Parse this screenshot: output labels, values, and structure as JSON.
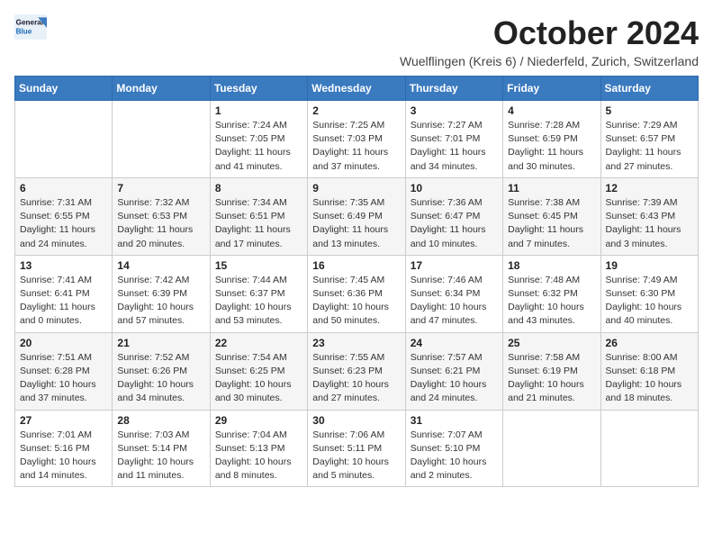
{
  "header": {
    "logo_line1": "General",
    "logo_line2": "Blue",
    "title": "October 2024",
    "subtitle": "Wuelflingen (Kreis 6) / Niederfeld, Zurich, Switzerland"
  },
  "days_of_week": [
    "Sunday",
    "Monday",
    "Tuesday",
    "Wednesday",
    "Thursday",
    "Friday",
    "Saturday"
  ],
  "weeks": [
    [
      {
        "day": "",
        "sunrise": "",
        "sunset": "",
        "daylight": ""
      },
      {
        "day": "",
        "sunrise": "",
        "sunset": "",
        "daylight": ""
      },
      {
        "day": "1",
        "sunrise": "Sunrise: 7:24 AM",
        "sunset": "Sunset: 7:05 PM",
        "daylight": "Daylight: 11 hours and 41 minutes."
      },
      {
        "day": "2",
        "sunrise": "Sunrise: 7:25 AM",
        "sunset": "Sunset: 7:03 PM",
        "daylight": "Daylight: 11 hours and 37 minutes."
      },
      {
        "day": "3",
        "sunrise": "Sunrise: 7:27 AM",
        "sunset": "Sunset: 7:01 PM",
        "daylight": "Daylight: 11 hours and 34 minutes."
      },
      {
        "day": "4",
        "sunrise": "Sunrise: 7:28 AM",
        "sunset": "Sunset: 6:59 PM",
        "daylight": "Daylight: 11 hours and 30 minutes."
      },
      {
        "day": "5",
        "sunrise": "Sunrise: 7:29 AM",
        "sunset": "Sunset: 6:57 PM",
        "daylight": "Daylight: 11 hours and 27 minutes."
      }
    ],
    [
      {
        "day": "6",
        "sunrise": "Sunrise: 7:31 AM",
        "sunset": "Sunset: 6:55 PM",
        "daylight": "Daylight: 11 hours and 24 minutes."
      },
      {
        "day": "7",
        "sunrise": "Sunrise: 7:32 AM",
        "sunset": "Sunset: 6:53 PM",
        "daylight": "Daylight: 11 hours and 20 minutes."
      },
      {
        "day": "8",
        "sunrise": "Sunrise: 7:34 AM",
        "sunset": "Sunset: 6:51 PM",
        "daylight": "Daylight: 11 hours and 17 minutes."
      },
      {
        "day": "9",
        "sunrise": "Sunrise: 7:35 AM",
        "sunset": "Sunset: 6:49 PM",
        "daylight": "Daylight: 11 hours and 13 minutes."
      },
      {
        "day": "10",
        "sunrise": "Sunrise: 7:36 AM",
        "sunset": "Sunset: 6:47 PM",
        "daylight": "Daylight: 11 hours and 10 minutes."
      },
      {
        "day": "11",
        "sunrise": "Sunrise: 7:38 AM",
        "sunset": "Sunset: 6:45 PM",
        "daylight": "Daylight: 11 hours and 7 minutes."
      },
      {
        "day": "12",
        "sunrise": "Sunrise: 7:39 AM",
        "sunset": "Sunset: 6:43 PM",
        "daylight": "Daylight: 11 hours and 3 minutes."
      }
    ],
    [
      {
        "day": "13",
        "sunrise": "Sunrise: 7:41 AM",
        "sunset": "Sunset: 6:41 PM",
        "daylight": "Daylight: 11 hours and 0 minutes."
      },
      {
        "day": "14",
        "sunrise": "Sunrise: 7:42 AM",
        "sunset": "Sunset: 6:39 PM",
        "daylight": "Daylight: 10 hours and 57 minutes."
      },
      {
        "day": "15",
        "sunrise": "Sunrise: 7:44 AM",
        "sunset": "Sunset: 6:37 PM",
        "daylight": "Daylight: 10 hours and 53 minutes."
      },
      {
        "day": "16",
        "sunrise": "Sunrise: 7:45 AM",
        "sunset": "Sunset: 6:36 PM",
        "daylight": "Daylight: 10 hours and 50 minutes."
      },
      {
        "day": "17",
        "sunrise": "Sunrise: 7:46 AM",
        "sunset": "Sunset: 6:34 PM",
        "daylight": "Daylight: 10 hours and 47 minutes."
      },
      {
        "day": "18",
        "sunrise": "Sunrise: 7:48 AM",
        "sunset": "Sunset: 6:32 PM",
        "daylight": "Daylight: 10 hours and 43 minutes."
      },
      {
        "day": "19",
        "sunrise": "Sunrise: 7:49 AM",
        "sunset": "Sunset: 6:30 PM",
        "daylight": "Daylight: 10 hours and 40 minutes."
      }
    ],
    [
      {
        "day": "20",
        "sunrise": "Sunrise: 7:51 AM",
        "sunset": "Sunset: 6:28 PM",
        "daylight": "Daylight: 10 hours and 37 minutes."
      },
      {
        "day": "21",
        "sunrise": "Sunrise: 7:52 AM",
        "sunset": "Sunset: 6:26 PM",
        "daylight": "Daylight: 10 hours and 34 minutes."
      },
      {
        "day": "22",
        "sunrise": "Sunrise: 7:54 AM",
        "sunset": "Sunset: 6:25 PM",
        "daylight": "Daylight: 10 hours and 30 minutes."
      },
      {
        "day": "23",
        "sunrise": "Sunrise: 7:55 AM",
        "sunset": "Sunset: 6:23 PM",
        "daylight": "Daylight: 10 hours and 27 minutes."
      },
      {
        "day": "24",
        "sunrise": "Sunrise: 7:57 AM",
        "sunset": "Sunset: 6:21 PM",
        "daylight": "Daylight: 10 hours and 24 minutes."
      },
      {
        "day": "25",
        "sunrise": "Sunrise: 7:58 AM",
        "sunset": "Sunset: 6:19 PM",
        "daylight": "Daylight: 10 hours and 21 minutes."
      },
      {
        "day": "26",
        "sunrise": "Sunrise: 8:00 AM",
        "sunset": "Sunset: 6:18 PM",
        "daylight": "Daylight: 10 hours and 18 minutes."
      }
    ],
    [
      {
        "day": "27",
        "sunrise": "Sunrise: 7:01 AM",
        "sunset": "Sunset: 5:16 PM",
        "daylight": "Daylight: 10 hours and 14 minutes."
      },
      {
        "day": "28",
        "sunrise": "Sunrise: 7:03 AM",
        "sunset": "Sunset: 5:14 PM",
        "daylight": "Daylight: 10 hours and 11 minutes."
      },
      {
        "day": "29",
        "sunrise": "Sunrise: 7:04 AM",
        "sunset": "Sunset: 5:13 PM",
        "daylight": "Daylight: 10 hours and 8 minutes."
      },
      {
        "day": "30",
        "sunrise": "Sunrise: 7:06 AM",
        "sunset": "Sunset: 5:11 PM",
        "daylight": "Daylight: 10 hours and 5 minutes."
      },
      {
        "day": "31",
        "sunrise": "Sunrise: 7:07 AM",
        "sunset": "Sunset: 5:10 PM",
        "daylight": "Daylight: 10 hours and 2 minutes."
      },
      {
        "day": "",
        "sunrise": "",
        "sunset": "",
        "daylight": ""
      },
      {
        "day": "",
        "sunrise": "",
        "sunset": "",
        "daylight": ""
      }
    ]
  ]
}
